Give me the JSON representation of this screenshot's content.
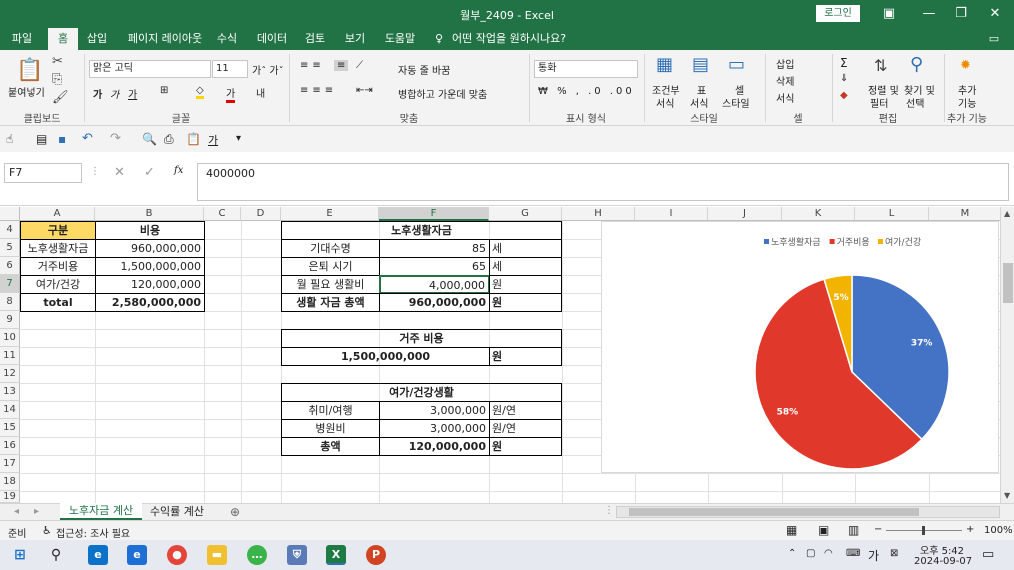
{
  "window": {
    "title": "월부_2409  -  Excel",
    "login": "로그인"
  },
  "tabs": [
    "파일",
    "홈",
    "삽입",
    "페이지 레이아웃",
    "수식",
    "데이터",
    "검토",
    "보기",
    "도움말"
  ],
  "tell_me": "어떤 작업을 원하시나요?",
  "ribbon": {
    "paste": "붙여넣기",
    "clipboard": "클립보드",
    "font_name": "맑은 고딕",
    "font_size": "11",
    "font_group": "글꼴",
    "wrap_text": "자동 줄 바꿈",
    "merge_center": "병합하고 가운데 맞춤",
    "align_group": "맞춤",
    "number_format": "통화",
    "number_group": "표시 형식",
    "cond_format": "조건부",
    "cond_format2": "서식",
    "table_format": "표",
    "table_format2": "서식",
    "cell_style": "셀",
    "cell_style2": "스타일",
    "style_group": "스타일",
    "insert": "삽입",
    "delete": "삭제",
    "format": "서식",
    "cells_group": "셀",
    "sort_filter": "정렬 및",
    "sort_filter2": "필터",
    "find_select": "찾기 및",
    "find_select2": "선택",
    "edit_group": "편집",
    "addins": "추가",
    "addins2": "기능",
    "addins_group": "추가 기능"
  },
  "formula_bar": {
    "name_box": "F7",
    "fx": "fx",
    "value": "4000000"
  },
  "columns": [
    "A",
    "B",
    "C",
    "D",
    "E",
    "F",
    "G",
    "H",
    "I",
    "J",
    "K",
    "L",
    "M"
  ],
  "rows": [
    "4",
    "5",
    "6",
    "7",
    "8",
    "9",
    "10",
    "11",
    "12",
    "13",
    "14",
    "15",
    "16",
    "17",
    "18",
    "19"
  ],
  "summary_table": {
    "header": [
      "구분",
      "비용"
    ],
    "rows": [
      [
        "노후생활자금",
        "960,000,000"
      ],
      [
        "거주비용",
        "1,500,000,000"
      ],
      [
        "여가/건강",
        "120,000,000"
      ]
    ],
    "total": [
      "total",
      "2,580,000,000"
    ]
  },
  "retirement": {
    "title": "노후생활자금",
    "rows": [
      [
        "기대수명",
        "85",
        "세"
      ],
      [
        "은퇴 시기",
        "65",
        "세"
      ],
      [
        "월 필요 생활비",
        "4,000,000",
        "원"
      ],
      [
        "생활 자금 총액",
        "960,000,000",
        "원"
      ]
    ]
  },
  "housing": {
    "title": "거주 비용",
    "value": "1,500,000,000",
    "unit": "원"
  },
  "leisure": {
    "title": "여가/건강생활",
    "rows": [
      [
        "취미/여행",
        "3,000,000",
        "원/연"
      ],
      [
        "병원비",
        "3,000,000",
        "원/연"
      ],
      [
        "총액",
        "120,000,000",
        "원"
      ]
    ]
  },
  "chart_data": {
    "type": "pie",
    "categories": [
      "노후생활자금",
      "거주비용",
      "여가/건강"
    ],
    "values": [
      960000000,
      1500000000,
      120000000
    ],
    "labels": [
      "37%",
      "58%",
      "5%"
    ],
    "colors": [
      "#4472c4",
      "#e0392b",
      "#f2b400"
    ],
    "legend": "top"
  },
  "sheet_tabs": [
    "노후자금 계산",
    "수익률 계산"
  ],
  "status": {
    "ready": "준비",
    "accessibility": "접근성: 조사 필요",
    "zoom": "100%"
  },
  "taskbar": {
    "time": "오후 5:42",
    "date": "2024-09-07",
    "ime": "가"
  }
}
